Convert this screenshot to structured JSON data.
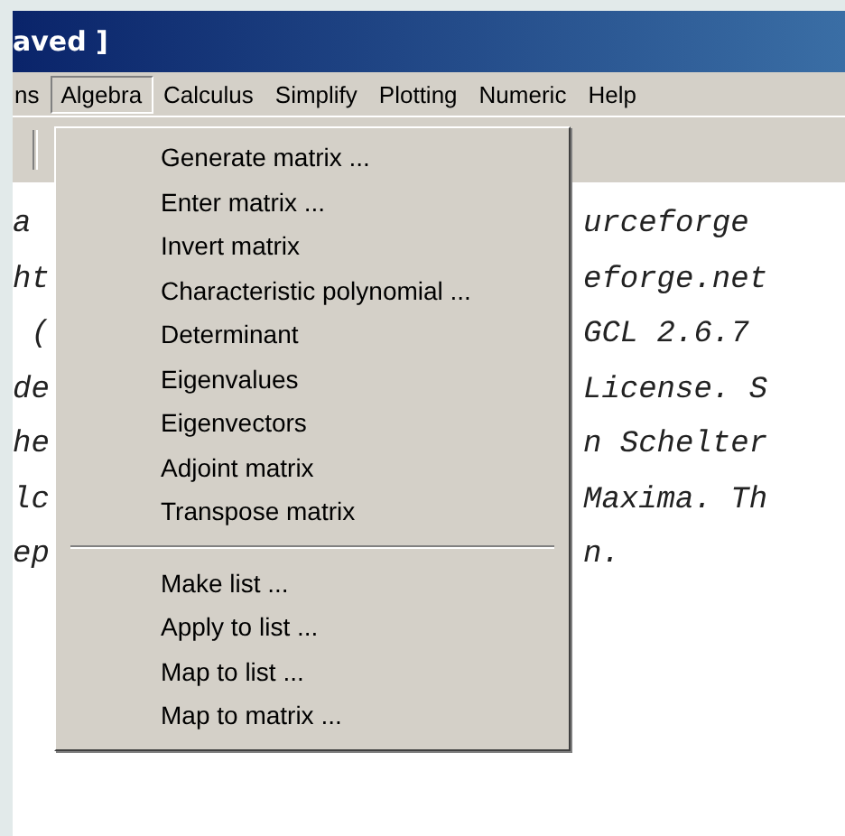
{
  "window": {
    "title": "aved ]"
  },
  "menu_bar": [
    {
      "label": "ns",
      "selected": false
    },
    {
      "label": "Algebra",
      "selected": true
    },
    {
      "label": "Calculus",
      "selected": false
    },
    {
      "label": "Simplify",
      "selected": false
    },
    {
      "label": "Plotting",
      "selected": false
    },
    {
      "label": "Numeric",
      "selected": false
    },
    {
      "label": "Help",
      "selected": false
    }
  ],
  "menu": {
    "items": [
      {
        "kind": "item",
        "label": "Generate matrix ..."
      },
      {
        "kind": "item",
        "label": "Enter matrix ..."
      },
      {
        "kind": "item",
        "label": "Invert matrix"
      },
      {
        "kind": "item",
        "label": "Characteristic polynomial ..."
      },
      {
        "kind": "item",
        "label": "Determinant"
      },
      {
        "kind": "item",
        "label": "Eigenvalues"
      },
      {
        "kind": "item",
        "label": "Eigenvectors"
      },
      {
        "kind": "item",
        "label": "Adjoint matrix"
      },
      {
        "kind": "item",
        "label": "Transpose matrix"
      },
      {
        "kind": "separator"
      },
      {
        "kind": "item",
        "label": "Make list ..."
      },
      {
        "kind": "item",
        "label": "Apply to list ..."
      },
      {
        "kind": "item",
        "label": "Map to list ..."
      },
      {
        "kind": "item",
        "label": "Map to matrix ..."
      }
    ]
  },
  "console": {
    "lines": [
      {
        "left": "a",
        "right": "urceforge"
      },
      {
        "left": "ht",
        "right": "eforge.net"
      },
      {
        "left": " (",
        "right": "GCL 2.6.7"
      },
      {
        "left": "de",
        "right": "License. S"
      },
      {
        "left": "he",
        "right": "n Schelter"
      },
      {
        "left": "lc",
        "right": "Maxima. Th"
      },
      {
        "left": "ep",
        "right": "n."
      }
    ]
  }
}
